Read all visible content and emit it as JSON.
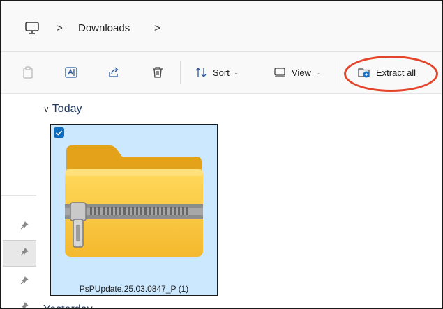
{
  "address_bar": {
    "root_icon": "monitor-icon",
    "separator": ">",
    "current": "Downloads"
  },
  "toolbar": {
    "sort_label": "Sort",
    "view_label": "View",
    "extract_label": "Extract all",
    "icons": [
      "paste-icon",
      "rename-icon",
      "share-icon",
      "delete-icon",
      "sort-icon",
      "view-icon",
      "extract-icon"
    ]
  },
  "groups": [
    {
      "header": "Today",
      "items": [
        {
          "name": "PsPUpdate.25.03.0847_P (1)",
          "selected": true,
          "icon": "zip-folder-icon"
        }
      ]
    },
    {
      "header": "Yesterday"
    }
  ],
  "colors": {
    "selection": "#cce8ff",
    "checkbox": "#0f6cbd",
    "annotation": "#e2452a",
    "folder": "#f9c53b"
  }
}
